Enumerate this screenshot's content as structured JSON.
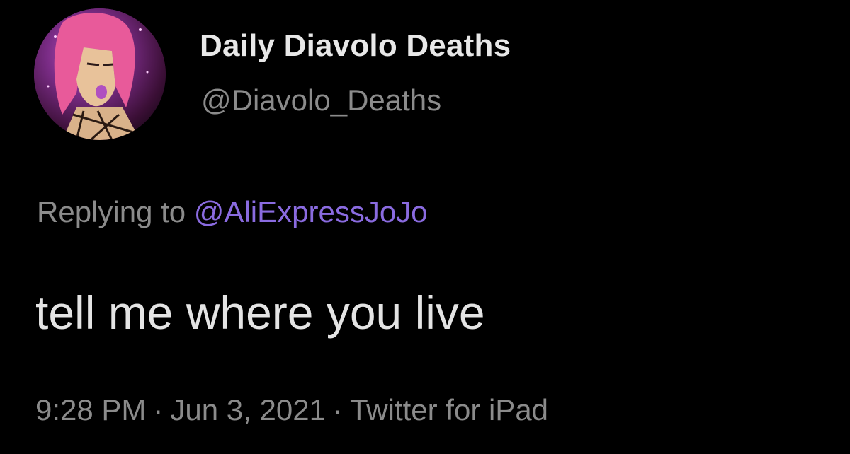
{
  "tweet": {
    "display_name": "Daily Diavolo Deaths",
    "handle": "@Diavolo_Deaths",
    "reply_prefix": "Replying to",
    "reply_target": "@AliExpressJoJo",
    "text": "tell me where you live",
    "time": "9:28 PM",
    "date": "Jun 3, 2021",
    "source": "Twitter for iPad",
    "separator": "·"
  },
  "colors": {
    "background": "#000000",
    "name": "#e8e8e8",
    "muted": "#8b8b8b",
    "mention": "#8a6be0"
  },
  "icons": {
    "avatar": "profile-avatar-icon"
  }
}
